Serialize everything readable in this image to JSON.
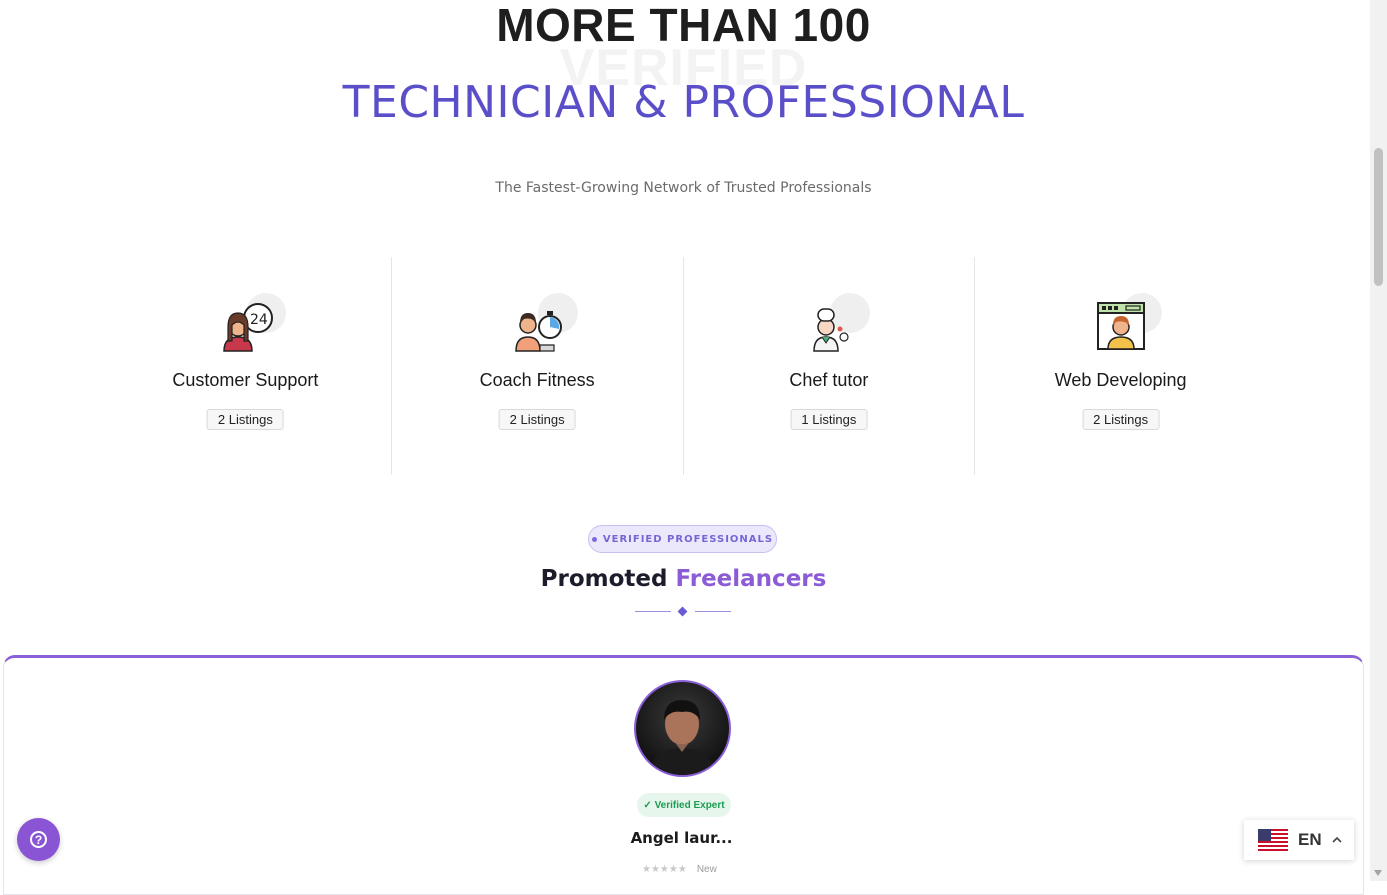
{
  "hero": {
    "line1": "MORE THAN 100",
    "ghost_word": "VERIFIED",
    "line2": "TECHNICIAN & PROFESSIONAL",
    "subtitle": "The Fastest-Growing Network of Trusted Professionals"
  },
  "categories": [
    {
      "title": "Customer Support",
      "listings": "2 Listings",
      "icon": "customer-support-24-icon"
    },
    {
      "title": "Coach Fitness",
      "listings": "2 Listings",
      "icon": "fitness-coach-stopwatch-icon"
    },
    {
      "title": "Chef tutor",
      "listings": "1 Listings",
      "icon": "chef-icon"
    },
    {
      "title": "Web Developing",
      "listings": "2 Listings",
      "icon": "web-developer-icon"
    }
  ],
  "promoted": {
    "pill_label": "VERIFIED PROFESSIONALS",
    "title_part1": "Promoted",
    "title_part2": "Freelancers"
  },
  "freelancer_card": {
    "verified_label": "✓ Verified Expert",
    "name": "Angel laur...",
    "stars": "★★★★★",
    "rating_label": "New"
  },
  "language": {
    "code": "EN",
    "flag": "us-flag-icon"
  },
  "colors": {
    "accent_purple": "#5b4fc9",
    "freelancers_purple": "#8b5cd6",
    "verified_green": "#1c9c52",
    "help_button": "#8a55d4"
  }
}
